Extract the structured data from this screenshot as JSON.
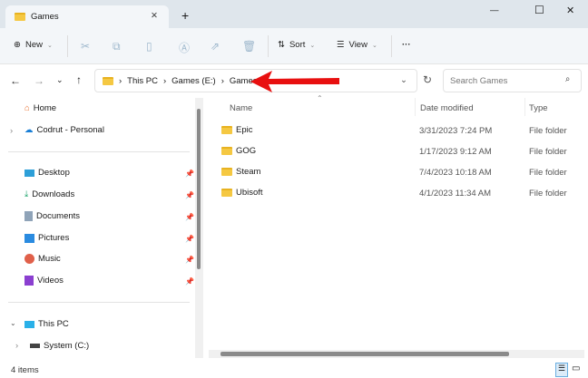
{
  "tab": {
    "title": "Games",
    "close": "✕",
    "new_tab": "+"
  },
  "window": {
    "minimize": "—",
    "maximize": "☐",
    "close": "✕"
  },
  "toolbar": {
    "new": "New",
    "sort": "Sort",
    "view": "View",
    "more": "···"
  },
  "address": {
    "crumbs": [
      "This PC",
      "Games (E:)",
      "Games"
    ],
    "search_placeholder": "Search Games"
  },
  "sidebar": {
    "home": "Home",
    "onedrive": "Codrut - Personal",
    "quick": [
      "Desktop",
      "Downloads",
      "Documents",
      "Pictures",
      "Music",
      "Videos"
    ],
    "this_pc": "This PC",
    "system": "System (C:)"
  },
  "columns": {
    "name": "Name",
    "date": "Date modified",
    "type": "Type"
  },
  "files": [
    {
      "name": "Epic",
      "date": "3/31/2023 7:24 PM",
      "type": "File folder"
    },
    {
      "name": "GOG",
      "date": "1/17/2023 9:12 AM",
      "type": "File folder"
    },
    {
      "name": "Steam",
      "date": "7/4/2023 10:18 AM",
      "type": "File folder"
    },
    {
      "name": "Ubisoft",
      "date": "4/1/2023 11:34 AM",
      "type": "File folder"
    }
  ],
  "status": {
    "count": "4 items"
  },
  "colors": {
    "arrow": "#e81010"
  }
}
